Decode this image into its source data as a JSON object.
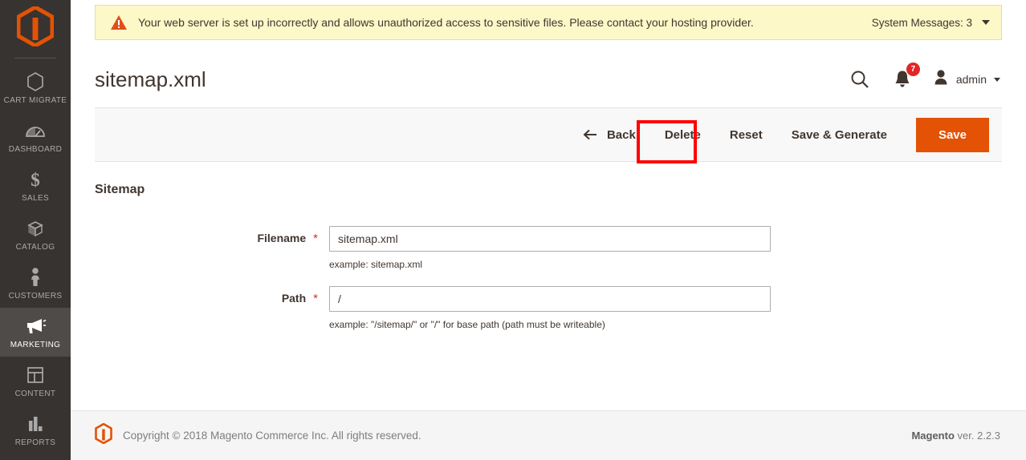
{
  "sidebar": {
    "logo_icon": "magento-logo-icon",
    "items": [
      {
        "label": "CART MIGRATE",
        "icon": "hexagon-icon",
        "active": false
      },
      {
        "label": "DASHBOARD",
        "icon": "dashboard-gauge-icon",
        "active": false
      },
      {
        "label": "SALES",
        "icon": "dollar-sign-icon",
        "active": false
      },
      {
        "label": "CATALOG",
        "icon": "boxes-icon",
        "active": false
      },
      {
        "label": "CUSTOMERS",
        "icon": "person-icon",
        "active": false
      },
      {
        "label": "MARKETING",
        "icon": "megaphone-icon",
        "active": true
      },
      {
        "label": "CONTENT",
        "icon": "layout-panels-icon",
        "active": false
      },
      {
        "label": "REPORTS",
        "icon": "bar-chart-icon",
        "active": false
      }
    ]
  },
  "banner": {
    "icon": "warning-triangle-icon",
    "text": "Your web server is set up incorrectly and allows unauthorized access to sensitive files. Please contact your hosting provider.",
    "system_messages_label": "System Messages: 3",
    "caret_icon": "chevron-down-icon",
    "background_color": "#fcf8c8",
    "icon_color": "#e04f1a"
  },
  "header": {
    "title": "sitemap.xml",
    "search_icon": "search-icon",
    "notifications_icon": "bell-icon",
    "notifications_count": "7",
    "notifications_badge_color": "#e22626",
    "avatar_icon": "user-avatar-icon",
    "admin_label": "admin",
    "admin_caret_icon": "chevron-down-icon"
  },
  "toolbar": {
    "back_icon": "arrow-left-icon",
    "back_label": "Back",
    "delete_label": "Delete",
    "reset_label": "Reset",
    "save_generate_label": "Save & Generate",
    "save_label": "Save",
    "save_color": "#e35205",
    "highlight_color": "#ff0000",
    "highlighted_button": "Delete"
  },
  "form": {
    "section_title": "Sitemap",
    "fields": [
      {
        "label": "Filename",
        "required_marker": "*",
        "value": "sitemap.xml",
        "note": "example: sitemap.xml"
      },
      {
        "label": "Path",
        "required_marker": "*",
        "value": "/",
        "note": "example: \"/sitemap/\" or \"/\" for base path (path must be writeable)"
      }
    ]
  },
  "footer": {
    "logo_icon": "magento-logo-icon",
    "copyright": "Copyright © 2018 Magento Commerce Inc. All rights reserved.",
    "brand": "Magento",
    "version": " ver. 2.2.3"
  }
}
